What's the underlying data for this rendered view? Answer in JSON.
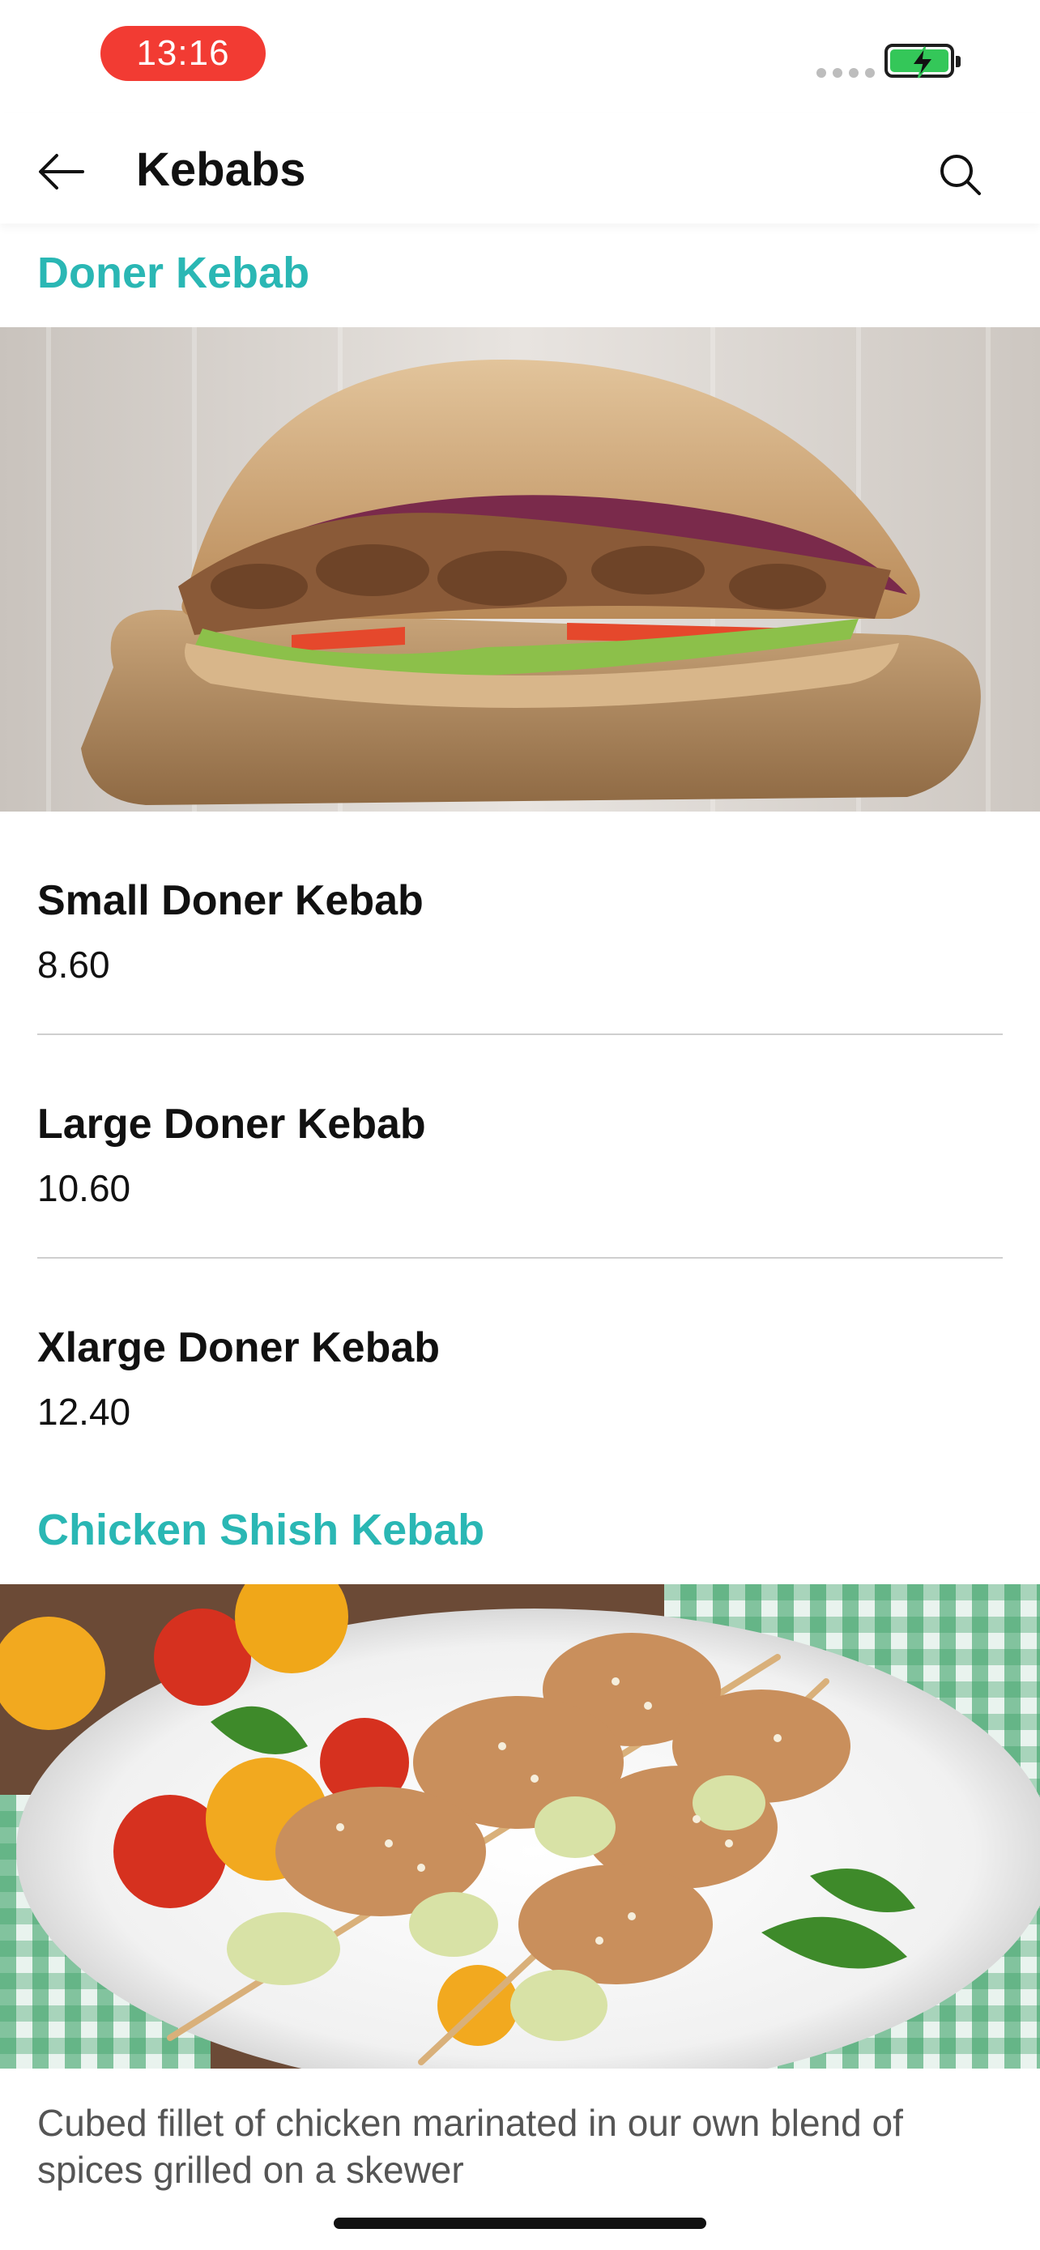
{
  "status_bar": {
    "time": "13:16",
    "signal_icon": "cellular-signal-icon",
    "battery_icon": "battery-charging-icon",
    "time_pill_color": "#f23b33",
    "battery_color": "#34c759"
  },
  "nav": {
    "title": "Kebabs",
    "back_icon": "arrow-left-icon",
    "search_icon": "search-icon"
  },
  "theme": {
    "accent": "#2ab7b4"
  },
  "sections": [
    {
      "title": "Doner Kebab",
      "image_icon": "doner-kebab-photo",
      "items": [
        {
          "name": "Small Doner Kebab",
          "price": "8.60"
        },
        {
          "name": "Large Doner Kebab",
          "price": "10.60"
        },
        {
          "name": "Xlarge Doner Kebab",
          "price": "12.40"
        }
      ]
    },
    {
      "title": "Chicken Shish Kebab",
      "image_icon": "chicken-shish-kebab-photo",
      "description": "Cubed fillet of chicken marinated in our own blend of spices grilled on a skewer"
    }
  ]
}
